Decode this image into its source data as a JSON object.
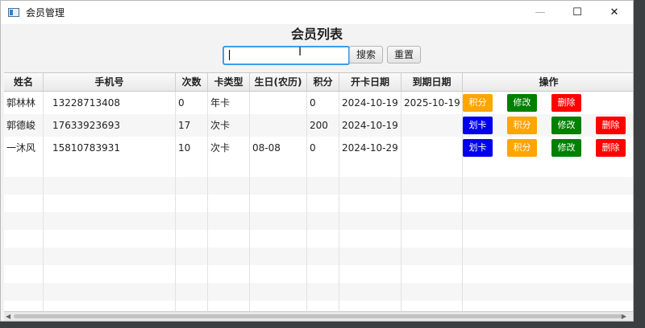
{
  "window": {
    "title": "会员管理"
  },
  "page": {
    "heading": "会员列表"
  },
  "search": {
    "value": "",
    "search_label": "搜索",
    "reset_label": "重置"
  },
  "columns": [
    "姓名",
    "手机号",
    "次数",
    "卡类型",
    "生日(农历)",
    "积分",
    "开卡日期",
    "到期日期",
    "操作"
  ],
  "rows": [
    {
      "name": "郭林林",
      "phone": "13228713408",
      "count": "0",
      "card_type": "年卡",
      "birthday": "",
      "points": "0",
      "open_date": "2024-10-19",
      "expire_date": "2025-10-19",
      "ops": [
        "积分",
        "修改",
        "删除"
      ]
    },
    {
      "name": "郭德峻",
      "phone": "17633923693",
      "count": "17",
      "card_type": "次卡",
      "birthday": "",
      "points": "200",
      "open_date": "2024-10-19",
      "expire_date": "",
      "ops": [
        "划卡",
        "积分",
        "修改",
        "删除"
      ]
    },
    {
      "name": "一沐风",
      "phone": "15810783931",
      "count": "10",
      "card_type": "次卡",
      "birthday": "08-08",
      "points": "0",
      "open_date": "2024-10-29",
      "expire_date": "",
      "ops": [
        "划卡",
        "积分",
        "修改",
        "删除"
      ]
    }
  ],
  "colors": {
    "recharge": "#0000ee",
    "points": "#ffa500",
    "edit": "#008000",
    "delete": "#ff0000",
    "focus": "#3d9ce8"
  }
}
